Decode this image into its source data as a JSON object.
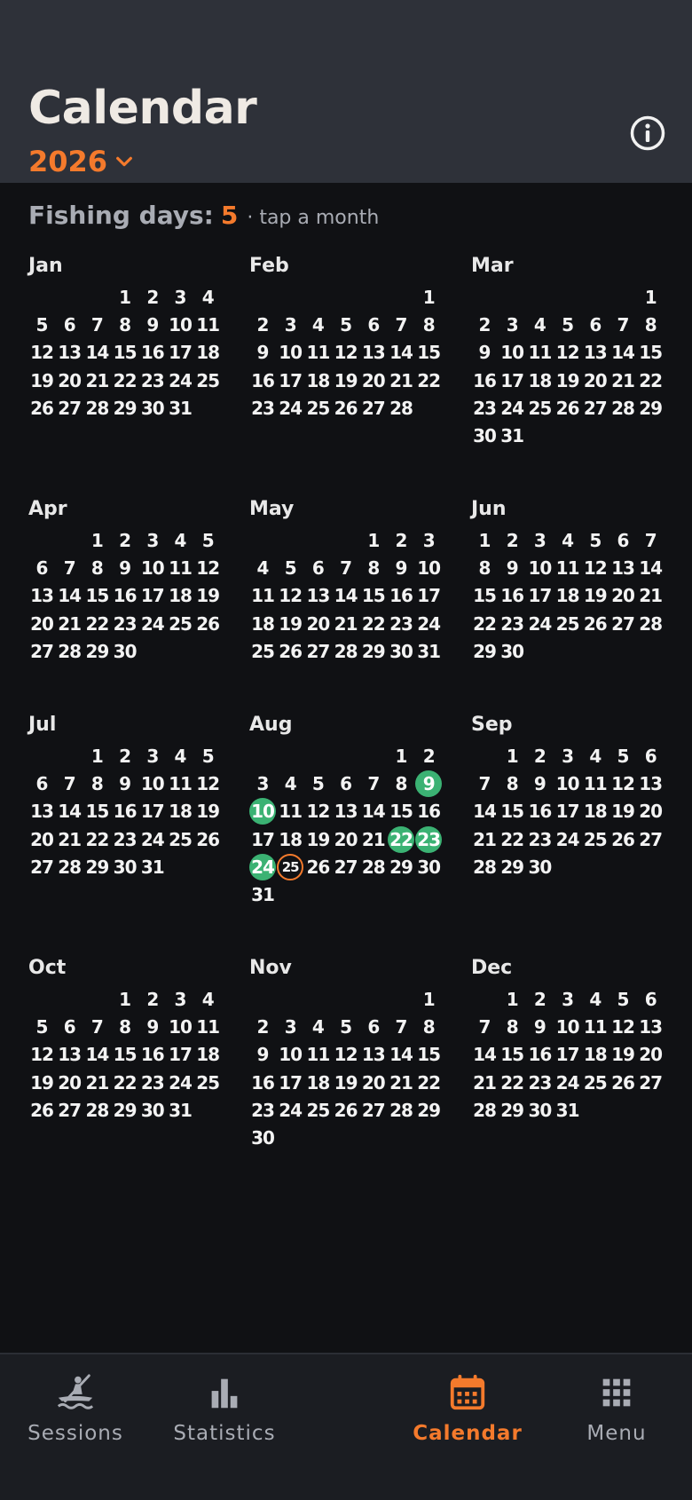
{
  "header": {
    "title": "Calendar",
    "year": "2026"
  },
  "summary": {
    "label": "Fishing days:",
    "count": "5",
    "hint": "· tap a month"
  },
  "colors": {
    "accent": "#f47a2c",
    "fishing_day": "#3bb273",
    "header_bg": "#2e3139",
    "page_bg": "#101114"
  },
  "months": [
    {
      "name": "Jan",
      "offset": 3,
      "days": 31
    },
    {
      "name": "Feb",
      "offset": 6,
      "days": 28
    },
    {
      "name": "Mar",
      "offset": 6,
      "days": 31
    },
    {
      "name": "Apr",
      "offset": 2,
      "days": 30
    },
    {
      "name": "May",
      "offset": 4,
      "days": 31
    },
    {
      "name": "Jun",
      "offset": 0,
      "days": 30
    },
    {
      "name": "Jul",
      "offset": 2,
      "days": 31
    },
    {
      "name": "Aug",
      "offset": 5,
      "days": 31,
      "fishing_days": [
        9,
        10,
        22,
        23,
        24
      ],
      "today": 25
    },
    {
      "name": "Sep",
      "offset": 1,
      "days": 30
    },
    {
      "name": "Oct",
      "offset": 3,
      "days": 31
    },
    {
      "name": "Nov",
      "offset": 6,
      "days": 30
    },
    {
      "name": "Dec",
      "offset": 1,
      "days": 31
    }
  ],
  "nav": [
    {
      "label": "Sessions",
      "icon": "kayak-icon",
      "active": false
    },
    {
      "label": "Statistics",
      "icon": "bar-chart-icon",
      "active": false
    },
    {
      "label": "Calendar",
      "icon": "calendar-icon",
      "active": true
    },
    {
      "label": "Menu",
      "icon": "grid-icon",
      "active": false
    }
  ]
}
